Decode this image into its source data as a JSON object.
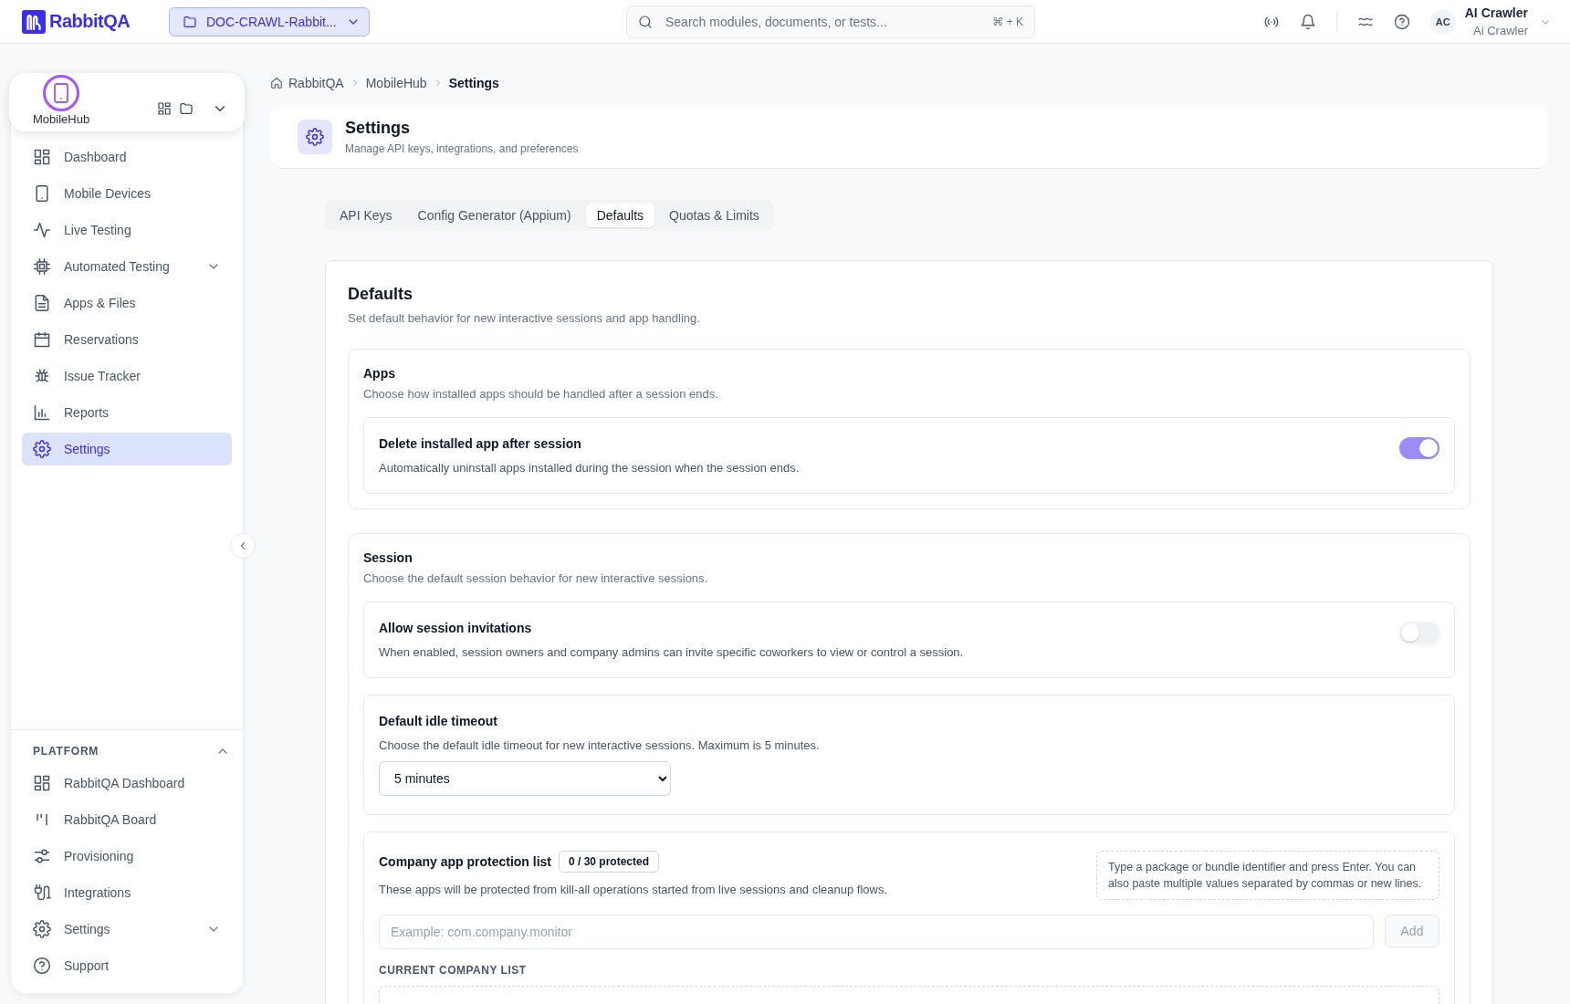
{
  "app": {
    "name": "RabbitQA"
  },
  "project": {
    "label": "DOC-CRAWL-Rabbit..."
  },
  "search": {
    "placeholder": "Search modules, documents, or tests...",
    "shortcut": "⌘ + K"
  },
  "user": {
    "initials": "AC",
    "name": "AI Crawler",
    "role": "Ai Crawler"
  },
  "sidebar": {
    "workspace": "MobileHub",
    "items": [
      {
        "label": "Dashboard",
        "kind": "link",
        "selected": false
      },
      {
        "label": "Mobile Devices",
        "kind": "link",
        "selected": false
      },
      {
        "label": "Live Testing",
        "kind": "link",
        "selected": false
      },
      {
        "label": "Automated Testing",
        "kind": "group",
        "expanded": false,
        "selected": false
      },
      {
        "label": "Apps & Files",
        "kind": "link",
        "selected": false
      },
      {
        "label": "Reservations",
        "kind": "link",
        "selected": false
      },
      {
        "label": "Issue Tracker",
        "kind": "link",
        "selected": false
      },
      {
        "label": "Reports",
        "kind": "link",
        "selected": false
      },
      {
        "label": "Settings",
        "kind": "link",
        "selected": true
      }
    ],
    "platform": {
      "title": "PLATFORM",
      "expanded": true,
      "items": [
        {
          "label": "RabbitQA Dashboard",
          "kind": "link"
        },
        {
          "label": "RabbitQA Board",
          "kind": "link"
        },
        {
          "label": "Provisioning",
          "kind": "link"
        },
        {
          "label": "Integrations",
          "kind": "link"
        },
        {
          "label": "Settings",
          "kind": "group",
          "expanded": false
        },
        {
          "label": "Support",
          "kind": "link"
        }
      ]
    }
  },
  "breadcrumb": [
    "RabbitQA",
    "MobileHub",
    "Settings"
  ],
  "header": {
    "title": "Settings",
    "subtitle": "Manage API keys, integrations, and preferences"
  },
  "tabs": [
    {
      "label": "API Keys",
      "selected": false
    },
    {
      "label": "Config Generator (Appium)",
      "selected": false
    },
    {
      "label": "Defaults",
      "selected": true
    },
    {
      "label": "Quotas & Limits",
      "selected": false
    }
  ],
  "defaults": {
    "title": "Defaults",
    "description": "Set default behavior for new interactive sessions and app handling.",
    "sections": [
      {
        "title": "Apps",
        "description": "Choose how installed apps should be handled after a session ends.",
        "items": [
          {
            "kind": "toggle",
            "label": "Delete installed app after session",
            "description": "Automatically uninstall apps installed during the session when the session ends.",
            "on": true
          }
        ]
      },
      {
        "title": "Session",
        "description": "Choose the default session behavior for new interactive sessions.",
        "items": [
          {
            "kind": "toggle",
            "label": "Allow session invitations",
            "description": "When enabled, session owners and company admins can invite specific coworkers to view or control a session.",
            "on": false
          },
          {
            "kind": "select",
            "label": "Default idle timeout",
            "description": "Choose the default idle timeout for new interactive sessions. Maximum is 5 minutes.",
            "value": "5 minutes"
          },
          {
            "kind": "protection_list",
            "label": "Company app protection list",
            "badge": "0 / 30 protected",
            "description": "These apps will be protected from kill-all operations started from live sessions and cleanup flows.",
            "hint": "Type a package or bundle identifier and press Enter. You can also paste multiple values separated by commas or new lines.",
            "placeholder": "Example: com.company.monitor",
            "button": {
              "label": "Add",
              "disabled": true
            },
            "list_heading": "CURRENT COMPANY LIST"
          }
        ]
      }
    ]
  }
}
